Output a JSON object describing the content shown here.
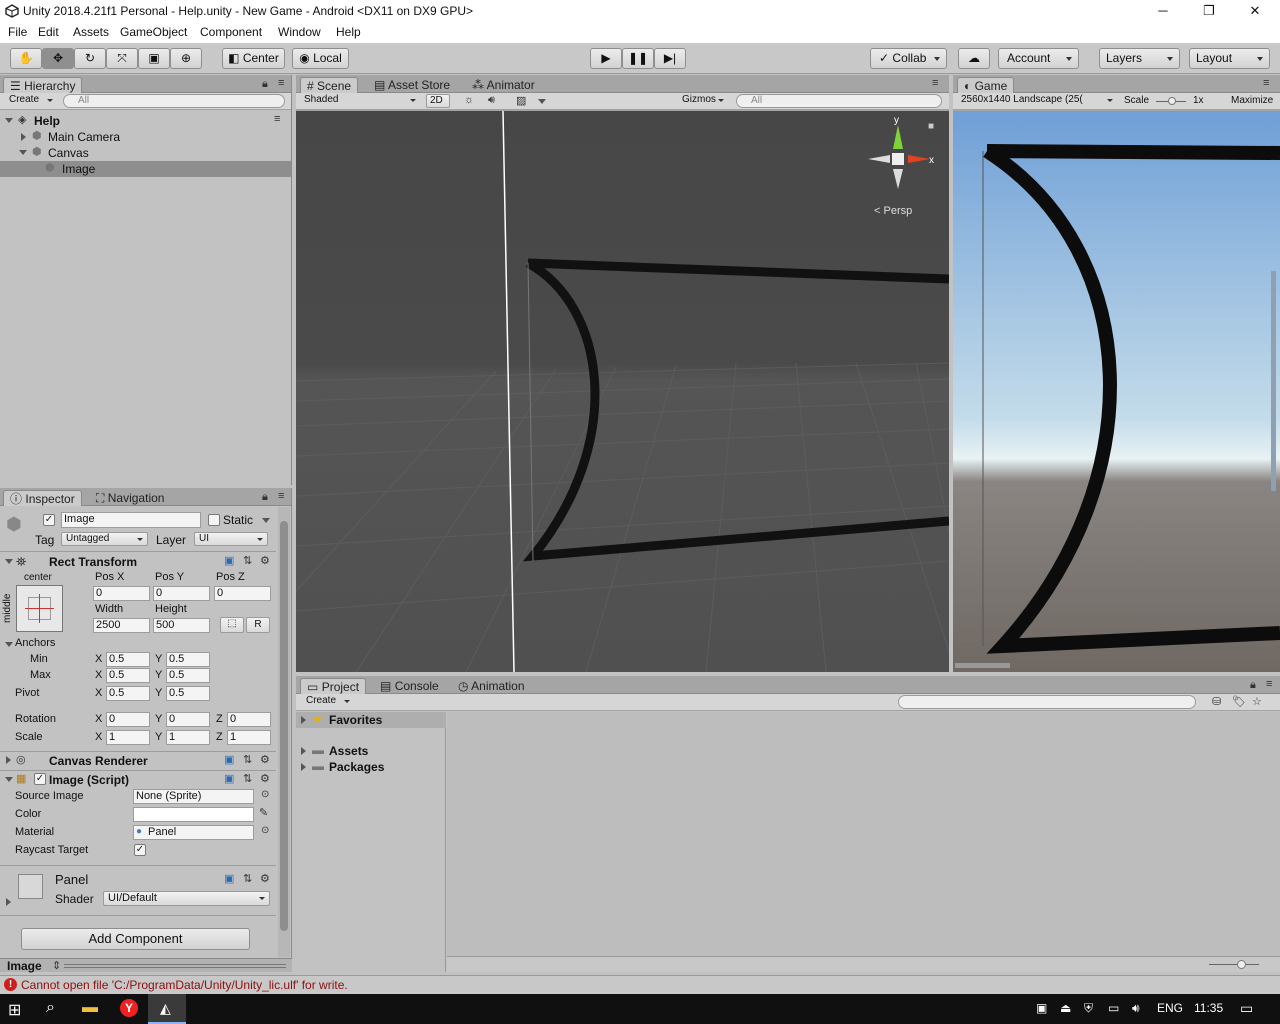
{
  "window": {
    "title": "Unity 2018.4.21f1 Personal - Help.unity - New Game - Android <DX11 on DX9 GPU>",
    "minimize": "─",
    "restore": "❐",
    "close": "✕"
  },
  "menu": [
    "File",
    "Edit",
    "Assets",
    "GameObject",
    "Component",
    "Window",
    "Help"
  ],
  "toolbar": {
    "center": "Center",
    "local": "Local",
    "collab": "Collab",
    "account": "Account",
    "layers": "Layers",
    "layout": "Layout"
  },
  "hierarchy": {
    "tab": "Hierarchy",
    "create": "Create",
    "search_placeholder": "All",
    "scene": "Help",
    "items": [
      "Main Camera",
      "Canvas",
      "Image"
    ]
  },
  "scene": {
    "tabs": [
      "Scene",
      "Asset Store",
      "Animator"
    ],
    "shading": "Shaded",
    "mode2d": "2D",
    "gizmos": "Gizmos",
    "search_placeholder": "All",
    "persp": "Persp",
    "axis_x": "x",
    "axis_y": "y"
  },
  "game": {
    "tab": "Game",
    "resolution": "2560x1440 Landscape (25(",
    "scale_label": "Scale",
    "scale_value": "1x",
    "maximize": "Maximize"
  },
  "inspector": {
    "tabs": [
      "Inspector",
      "Navigation"
    ],
    "object_name": "Image",
    "static_label": "Static",
    "tag_label": "Tag",
    "tag_value": "Untagged",
    "layer_label": "Layer",
    "layer_value": "UI",
    "rect": {
      "title": "Rect Transform",
      "anchor_h": "center",
      "anchor_v": "middle",
      "posx_label": "Pos X",
      "posy_label": "Pos Y",
      "posz_label": "Pos Z",
      "posx": "0",
      "posy": "0",
      "posz": "0",
      "width_label": "Width",
      "height_label": "Height",
      "width": "2500",
      "height": "500",
      "r_btn": "R",
      "anchors_label": "Anchors",
      "min_label": "Min",
      "max_label": "Max",
      "pivot_label": "Pivot",
      "rotation_label": "Rotation",
      "scale_label": "Scale",
      "x": "X",
      "y": "Y",
      "z": "Z",
      "min_x": "0.5",
      "min_y": "0.5",
      "max_x": "0.5",
      "max_y": "0.5",
      "pivot_x": "0.5",
      "pivot_y": "0.5",
      "rot_x": "0",
      "rot_y": "0",
      "rot_z": "0",
      "scale_x": "1",
      "scale_y": "1",
      "scale_z": "1"
    },
    "canvas_renderer": "Canvas Renderer",
    "image_script": {
      "title": "Image (Script)",
      "source_label": "Source Image",
      "source_value": "None (Sprite)",
      "color_label": "Color",
      "material_label": "Material",
      "material_value": "Panel",
      "raycast_label": "Raycast Target"
    },
    "material": {
      "name": "Panel",
      "shader_label": "Shader",
      "shader_value": "UI/Default"
    },
    "add_component": "Add Component",
    "footer": "Image"
  },
  "project": {
    "tabs": [
      "Project",
      "Console",
      "Animation"
    ],
    "create": "Create",
    "favorites": "Favorites",
    "folders": [
      "Assets",
      "Packages"
    ]
  },
  "status": {
    "error": "Cannot open file 'C:/ProgramData/Unity/Unity_lic.ulf' for write."
  },
  "taskbar": {
    "lang": "ENG",
    "time": "11:35"
  }
}
